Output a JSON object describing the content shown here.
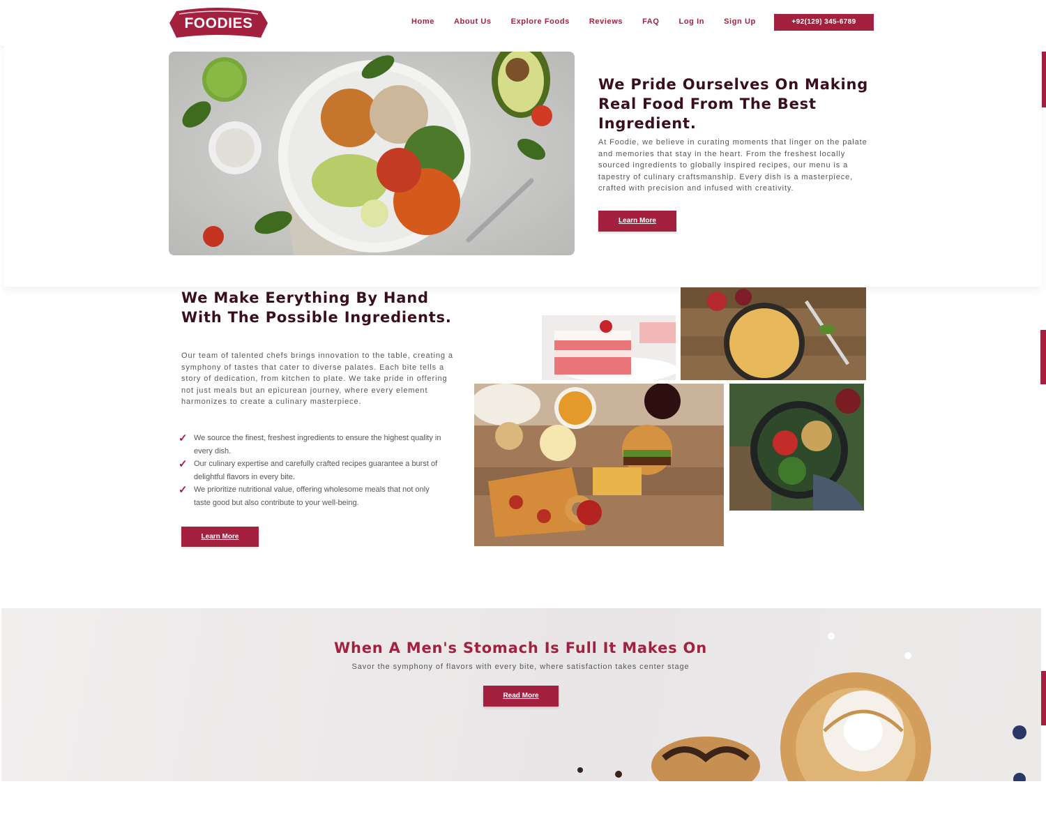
{
  "header": {
    "logo_text": "FOODIES",
    "nav": [
      "Home",
      "About Us",
      "Explore Foods",
      "Reviews",
      "FAQ",
      "Log In",
      "Sign Up"
    ],
    "phone": "+92(129) 345-6789"
  },
  "section1": {
    "title": "We Pride Ourselves On Making Real Food From The Best Ingredient.",
    "body": "At Foodie, we believe in curating moments that linger on the palate and memories that stay in the heart. From the freshest locally sourced ingredients to globally inspired recipes, our menu is a tapestry of culinary craftsmanship. Every dish is a masterpiece, crafted with precision and infused with creativity.",
    "button": "Learn More"
  },
  "section2": {
    "title": "We Make Eerything By Hand With The Possible Ingredients.",
    "body": "Our team of talented chefs brings innovation to the table, creating a symphony of tastes that cater to diverse palates. Each bite tells a story of dedication, from kitchen to plate. We take pride in offering not just meals but an epicurean journey, where every element harmonizes to create a culinary masterpiece.",
    "features": [
      "We source the finest, freshest ingredients to ensure the highest quality in every dish.",
      "Our culinary expertise and carefully crafted recipes guarantee a burst of delightful flavors in every bite.",
      "We prioritize nutritional value, offering wholesome meals that not only taste good but also contribute to your well-being."
    ],
    "button": "Learn More"
  },
  "section3": {
    "title": "When A Men's Stomach Is Full It Makes On",
    "subtitle": "Savor the symphony of flavors with every bite, where satisfaction takes center stage",
    "button": "Read More"
  },
  "colors": {
    "accent": "#a3213f",
    "heading": "#3a0f1c"
  }
}
